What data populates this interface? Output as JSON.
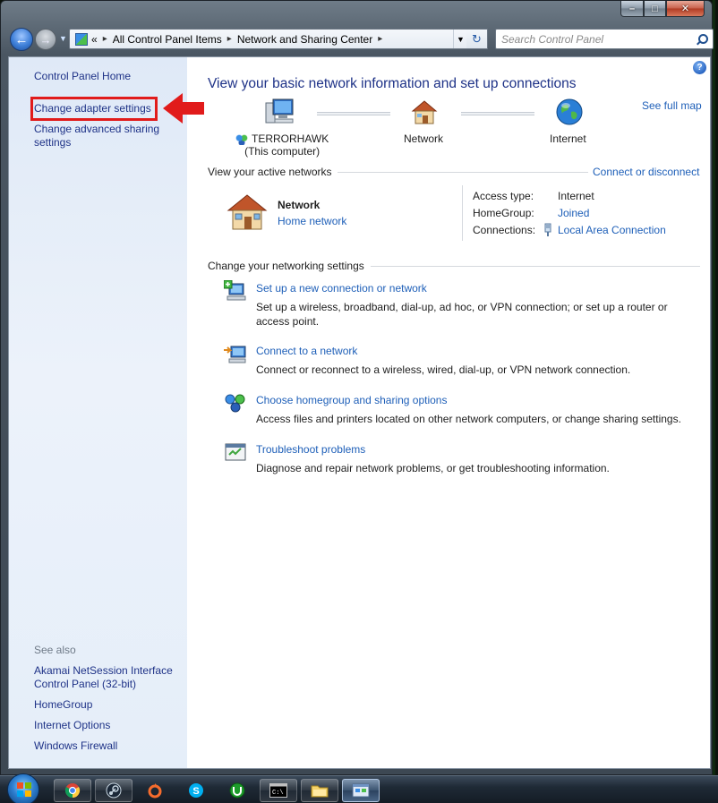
{
  "window": {
    "caption": {
      "minimize": "–",
      "maximize": "□",
      "close": "✕"
    }
  },
  "navbar": {
    "back_glyph": "←",
    "forward_glyph": "→",
    "breadcrumb_overflow": "«",
    "breadcrumbs": [
      "All Control Panel Items",
      "Network and Sharing Center"
    ],
    "breadcrumb_separator": "▸",
    "refresh_glyph": "↻",
    "search_placeholder": "Search Control Panel"
  },
  "sidebar": {
    "home": "Control Panel Home",
    "change_adapter": "Change adapter settings",
    "change_advanced_line1": "Change advanced sharing",
    "change_advanced_line2": "settings",
    "see_also": "See also",
    "akamai_line1": "Akamai NetSession Interface",
    "akamai_line2": "Control Panel (32-bit)",
    "homegroup": "HomeGroup",
    "internet_options": "Internet Options",
    "windows_firewall": "Windows Firewall"
  },
  "main": {
    "help_glyph": "?",
    "title": "View your basic network information and set up connections",
    "see_full_map": "See full map",
    "map": {
      "computer_name": "TERRORHAWK",
      "computer_sub": "(This computer)",
      "network": "Network",
      "internet": "Internet"
    },
    "active_networks": {
      "header": "View your active networks",
      "connect_link": "Connect or disconnect",
      "network_name": "Network",
      "network_type": "Home network",
      "access_type_label": "Access type:",
      "access_type_value": "Internet",
      "homegroup_label": "HomeGroup:",
      "homegroup_value": "Joined",
      "connections_label": "Connections:",
      "connections_value": "Local Area Connection"
    },
    "settings": {
      "header": "Change your networking settings",
      "tasks": [
        {
          "title": "Set up a new connection or network",
          "desc": "Set up a wireless, broadband, dial-up, ad hoc, or VPN connection; or set up a router or access point."
        },
        {
          "title": "Connect to a network",
          "desc": "Connect or reconnect to a wireless, wired, dial-up, or VPN network connection."
        },
        {
          "title": "Choose homegroup and sharing options",
          "desc": "Access files and printers located on other network computers, or change sharing settings."
        },
        {
          "title": "Troubleshoot problems",
          "desc": "Diagnose and repair network problems, or get troubleshooting information."
        }
      ]
    }
  },
  "taskbar": {
    "items": [
      "chrome-icon",
      "steam-icon",
      "origin-icon",
      "skype-icon",
      "utorrent-icon",
      "cmd-icon",
      "explorer-icon",
      "network-center-icon"
    ]
  },
  "colors": {
    "link": "#1e5fb8",
    "sidebar_link": "#1e3287",
    "highlight": "#e11b1b",
    "sidebar_bg": "#e5eef9"
  }
}
